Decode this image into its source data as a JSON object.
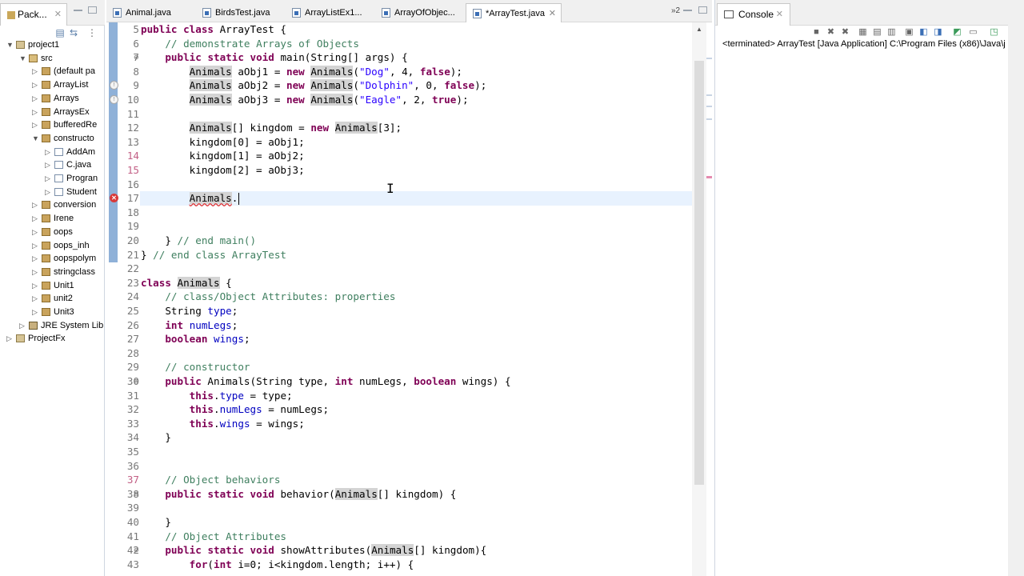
{
  "package_explorer": {
    "tab_label": "Pack...",
    "tree": [
      {
        "label": "project1",
        "depth": 0,
        "toggle": "v",
        "icon": "prj"
      },
      {
        "label": "src",
        "depth": 1,
        "toggle": "v",
        "icon": "src"
      },
      {
        "label": "(default pa",
        "depth": 2,
        "toggle": ">",
        "icon": "pkg"
      },
      {
        "label": "ArrayList",
        "depth": 2,
        "toggle": ">",
        "icon": "pkg"
      },
      {
        "label": "Arrays",
        "depth": 2,
        "toggle": ">",
        "icon": "pkg"
      },
      {
        "label": "ArraysEx",
        "depth": 2,
        "toggle": ">",
        "icon": "pkg"
      },
      {
        "label": "bufferedRe",
        "depth": 2,
        "toggle": ">",
        "icon": "pkg"
      },
      {
        "label": "constructo",
        "depth": 2,
        "toggle": "v",
        "icon": "pkg"
      },
      {
        "label": "AddAm",
        "depth": 3,
        "toggle": ">",
        "icon": "java"
      },
      {
        "label": "C.java",
        "depth": 3,
        "toggle": ">",
        "icon": "java"
      },
      {
        "label": "Progran",
        "depth": 3,
        "toggle": ">",
        "icon": "java"
      },
      {
        "label": "Student",
        "depth": 3,
        "toggle": ">",
        "icon": "java"
      },
      {
        "label": "conversion",
        "depth": 2,
        "toggle": ">",
        "icon": "pkg"
      },
      {
        "label": "Irene",
        "depth": 2,
        "toggle": ">",
        "icon": "pkg"
      },
      {
        "label": "oops",
        "depth": 2,
        "toggle": ">",
        "icon": "pkg"
      },
      {
        "label": "oops_inh",
        "depth": 2,
        "toggle": ">",
        "icon": "pkg"
      },
      {
        "label": "oopspolym",
        "depth": 2,
        "toggle": ">",
        "icon": "pkg"
      },
      {
        "label": "stringclass",
        "depth": 2,
        "toggle": ">",
        "icon": "pkg"
      },
      {
        "label": "Unit1",
        "depth": 2,
        "toggle": ">",
        "icon": "pkg"
      },
      {
        "label": "unit2",
        "depth": 2,
        "toggle": ">",
        "icon": "pkg"
      },
      {
        "label": "Unit3",
        "depth": 2,
        "toggle": ">",
        "icon": "pkg"
      },
      {
        "label": "JRE System Lib",
        "depth": 1,
        "toggle": ">",
        "icon": "lib"
      },
      {
        "label": "ProjectFx",
        "depth": 0,
        "toggle": ">",
        "icon": "prj"
      }
    ]
  },
  "editor": {
    "tabs": [
      {
        "label": "Animal.java",
        "active": false
      },
      {
        "label": "BirdsTest.java",
        "active": false
      },
      {
        "label": "ArrayListEx1...",
        "active": false
      },
      {
        "label": "ArrayOfObjec...",
        "active": false
      },
      {
        "label": "*ArrayTest.java",
        "active": true
      }
    ],
    "more_tabs": "»2",
    "lines": [
      {
        "n": "5",
        "html": "<span class=\"kw\">public</span> <span class=\"kw\">class</span> ArrayTest {"
      },
      {
        "n": "6",
        "html": "    <span class=\"cm\">// demonstrate Arrays of Objects</span>"
      },
      {
        "n": "7",
        "html": "    <span class=\"kw\">public</span> <span class=\"kw\">static</span> <span class=\"kw\">void</span> main(String[] args) {",
        "fold": true
      },
      {
        "n": "8",
        "html": "        <span class=\"occ\">Animals</span> aObj1 = <span class=\"kw\">new</span> <span class=\"occ\">Animals</span>(<span class=\"st\">\"Dog\"</span>, 4, <span class=\"kw\">false</span>);"
      },
      {
        "n": "9",
        "html": "        <span class=\"occ\">Animals</span> aObj2 = <span class=\"kw\">new</span> <span class=\"occ\">Animals</span>(<span class=\"st\">\"Dolphin\"</span>, 0, <span class=\"kw\">false</span>);",
        "warn": true
      },
      {
        "n": "10",
        "html": "        <span class=\"occ\">Animals</span> aObj3 = <span class=\"kw\">new</span> <span class=\"occ\">Animals</span>(<span class=\"st\">\"Eagle\"</span>, 2, <span class=\"kw\">true</span>);",
        "warn": true
      },
      {
        "n": "11",
        "html": ""
      },
      {
        "n": "12",
        "html": "        <span class=\"occ\">Animals</span>[] kingdom = <span class=\"kw\">new</span> <span class=\"occ\">Animals</span>[3];"
      },
      {
        "n": "13",
        "html": "        kingdom[0] = aObj1;"
      },
      {
        "n": "14",
        "html": "        kingdom[1] = aObj2;",
        "hl": true
      },
      {
        "n": "15",
        "html": "        kingdom[2] = aObj3;",
        "hl": true
      },
      {
        "n": "16",
        "html": ""
      },
      {
        "n": "17",
        "html": "        <span class=\"occ squig\">Animals</span>.<span class=\"cur\"></span>",
        "error": true,
        "current": true
      },
      {
        "n": "18",
        "html": ""
      },
      {
        "n": "19",
        "html": ""
      },
      {
        "n": "20",
        "html": "    } <span class=\"cm\">// end main()</span>"
      },
      {
        "n": "21",
        "html": "} <span class=\"cm\">// end class ArrayTest</span>"
      },
      {
        "n": "22",
        "html": ""
      },
      {
        "n": "23",
        "html": "<span class=\"kw\">class</span> <span class=\"occ\">Animals</span> {"
      },
      {
        "n": "24",
        "html": "    <span class=\"cm\">// class/Object Attributes: properties</span>"
      },
      {
        "n": "25",
        "html": "    String <span class=\"fd\">type</span>;"
      },
      {
        "n": "26",
        "html": "    <span class=\"kw\">int</span> <span class=\"fd\">numLegs</span>;"
      },
      {
        "n": "27",
        "html": "    <span class=\"kw\">boolean</span> <span class=\"fd\">wings</span>;"
      },
      {
        "n": "28",
        "html": ""
      },
      {
        "n": "29",
        "html": "    <span class=\"cm\">// constructor</span>"
      },
      {
        "n": "30",
        "html": "    <span class=\"kw\">public</span> Animals(String type, <span class=\"kw\">int</span> numLegs, <span class=\"kw\">boolean</span> wings) {",
        "fold": true
      },
      {
        "n": "31",
        "html": "        <span class=\"kw\">this</span>.<span class=\"fd\">type</span> = type;"
      },
      {
        "n": "32",
        "html": "        <span class=\"kw\">this</span>.<span class=\"fd\">numLegs</span> = numLegs;"
      },
      {
        "n": "33",
        "html": "        <span class=\"kw\">this</span>.<span class=\"fd\">wings</span> = wings;"
      },
      {
        "n": "34",
        "html": "    }"
      },
      {
        "n": "35",
        "html": ""
      },
      {
        "n": "36",
        "html": ""
      },
      {
        "n": "37",
        "html": "    <span class=\"cm\">// Object behaviors</span>",
        "hl": true
      },
      {
        "n": "38",
        "html": "    <span class=\"kw\">public</span> <span class=\"kw\">static</span> <span class=\"kw\">void</span> behavior(<span class=\"occ\">Animals</span>[] kingdom) {",
        "fold": true
      },
      {
        "n": "39",
        "html": ""
      },
      {
        "n": "40",
        "html": "    }"
      },
      {
        "n": "41",
        "html": "    <span class=\"cm\">// Object Attributes</span>"
      },
      {
        "n": "42",
        "html": "    <span class=\"kw\">public</span> <span class=\"kw\">static</span> <span class=\"kw\">void</span> showAttributes(<span class=\"occ\">Animals</span>[] kingdom){",
        "fold": true
      },
      {
        "n": "43",
        "html": "        <span class=\"kw\">for</span>(<span class=\"kw\">int</span> i=0; i&lt;kingdom.length; i++) {"
      }
    ]
  },
  "console": {
    "tab_label": "Console",
    "status_text": "<terminated> ArrayTest [Java Application] C:\\Program Files (x86)\\Java\\j"
  }
}
